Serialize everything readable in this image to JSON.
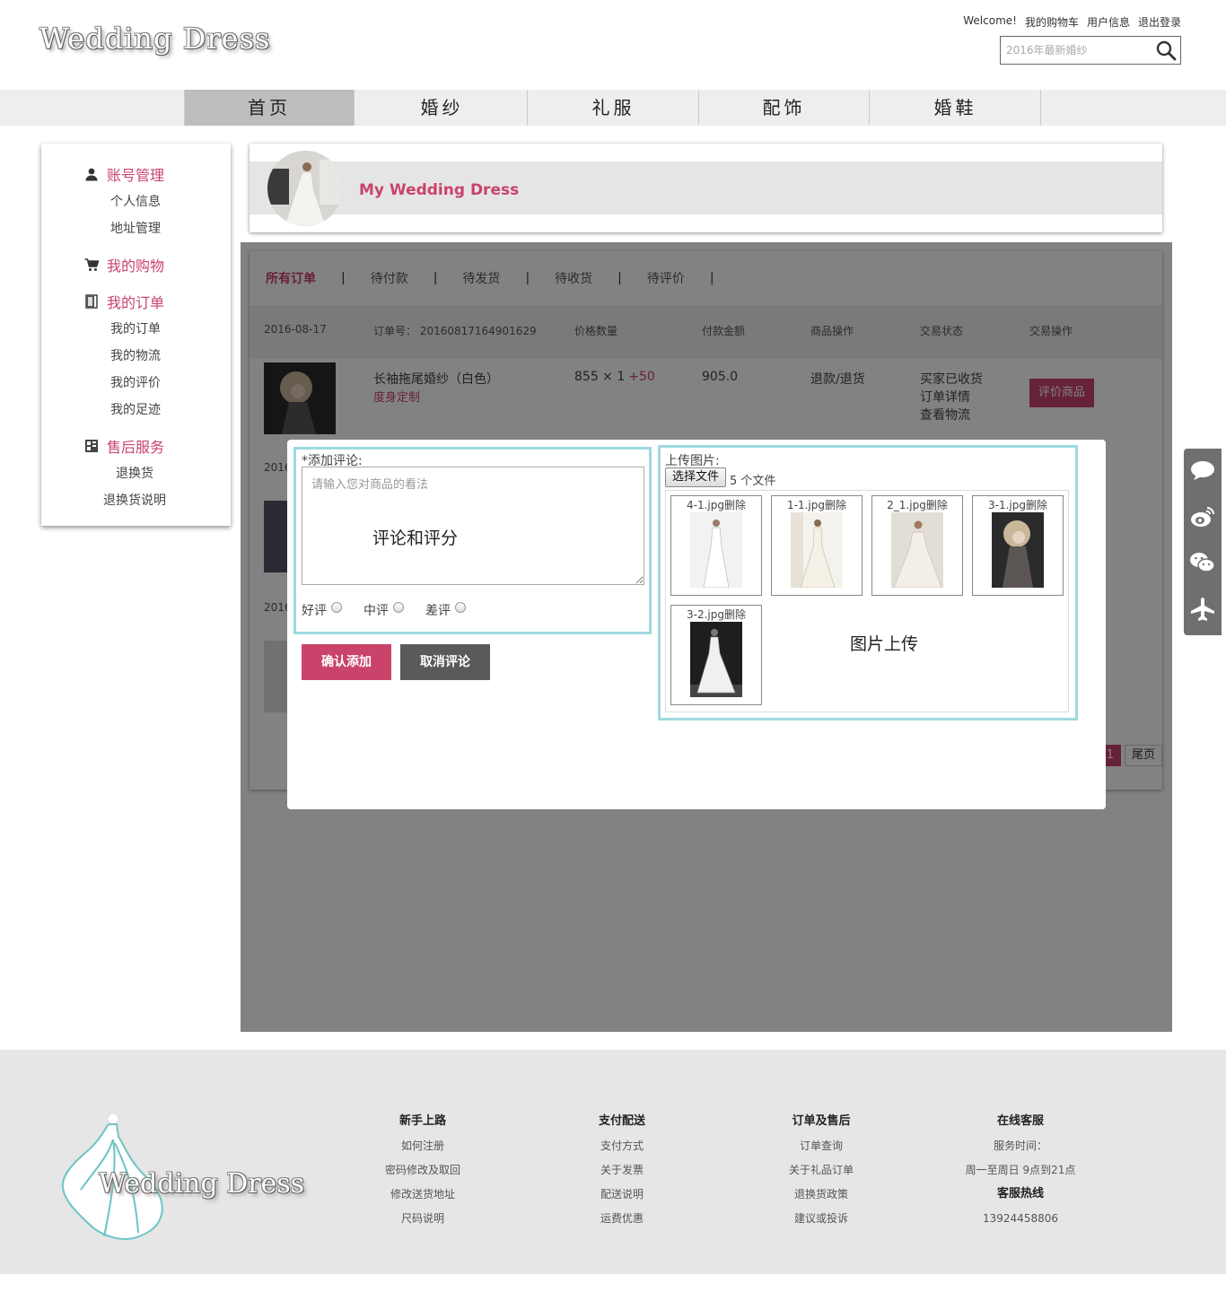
{
  "brand": {
    "logo_text": "Wedding Dress"
  },
  "top_links": {
    "welcome": "Welcome!",
    "cart": "我的购物车",
    "user_info": "用户信息",
    "logout": "退出登录"
  },
  "search": {
    "placeholder": "2016年最新婚纱",
    "icon": "search-icon"
  },
  "nav": {
    "items": [
      {
        "label": "首页",
        "active": true
      },
      {
        "label": "婚纱"
      },
      {
        "label": "礼服"
      },
      {
        "label": "配饰"
      },
      {
        "label": "婚鞋"
      }
    ]
  },
  "sidebar": {
    "account": {
      "title": "账号管理",
      "icon": "user-icon",
      "items": [
        "个人信息",
        "地址管理"
      ]
    },
    "shopping": {
      "title": "我的购物",
      "icon": "cart-icon"
    },
    "orders": {
      "title": "我的订单",
      "icon": "document-icon",
      "items": [
        "我的订单",
        "我的物流",
        "我的评价",
        "我的足迹"
      ]
    },
    "aftersale": {
      "title": "售后服务",
      "icon": "service-icon",
      "items": [
        "退换货",
        "退换货说明"
      ]
    }
  },
  "profile": {
    "title": "My Wedding Dress"
  },
  "orders": {
    "tabs": [
      "所有订单",
      "待付款",
      "待发货",
      "待收货",
      "待评价"
    ],
    "header": {
      "date": "2016-08-17",
      "order_no": "订单号： 20160817164901629",
      "price_qty": "价格数量",
      "pay_amount": "付款金额",
      "goods_op": "商品操作",
      "trade_status": "交易状态",
      "trade_op": "交易操作"
    },
    "first": {
      "name": "长袖拖尾婚纱（白色）",
      "custom": "度身定制",
      "price_qty": "855 × 1",
      "extra": "+50",
      "amount": "905.0",
      "goods_op": "退款/退货",
      "status": [
        "买家已收货",
        "订单详情",
        "查看物流"
      ],
      "action": "评价商品"
    },
    "date_partial_2": "2016",
    "date_partial_3": "2016",
    "pager": {
      "current": "1",
      "last": "尾页"
    }
  },
  "modal": {
    "comment_label": "*添加评论:",
    "comment_placeholder": "请输入您对商品的看法",
    "comment_hint": "评论和评分",
    "ratings": [
      "好评",
      "中评",
      "差评"
    ],
    "confirm": "确认添加",
    "cancel": "取消评论",
    "upload_label": "上传图片:",
    "choose_file": "选择文件",
    "file_count": "5 个文件",
    "upload_hint": "图片上传",
    "images": [
      {
        "name": "4-1.jpg",
        "del": "删除"
      },
      {
        "name": "1-1.jpg",
        "del": "删除"
      },
      {
        "name": "2_1.jpg",
        "del": "删除"
      },
      {
        "name": "3-1.jpg",
        "del": "删除"
      },
      {
        "name": "3-2.jpg",
        "del": "删除"
      }
    ]
  },
  "side_tools": [
    "chat-bubble-icon",
    "weibo-icon",
    "wechat-icon",
    "airplane-icon"
  ],
  "footer": {
    "logo_text": "Wedding Dress",
    "cols": [
      {
        "title": "新手上路",
        "items": [
          "如何注册",
          "密码修改及取回",
          "修改送货地址",
          "尺码说明"
        ]
      },
      {
        "title": "支付配送",
        "items": [
          "支付方式",
          "关于发票",
          "配送说明",
          "运费优惠"
        ]
      },
      {
        "title": "订单及售后",
        "items": [
          "订单查询",
          "关于礼品订单",
          "退换货政策",
          "建议或投诉"
        ]
      },
      {
        "title": "在线客服",
        "service_time_label": "服务时间：",
        "service_time": "周一至周日 9点到21点",
        "hotline_title": "客服热线",
        "hotline": "13924458806"
      }
    ]
  },
  "colors": {
    "accent": "#c9436b",
    "nav_bg": "#eeeeee",
    "nav_active": "#bdbdbd",
    "frame": "#9fd9e0",
    "footer_bg": "#e6e6e6",
    "button_gray": "#5a5a5a"
  }
}
